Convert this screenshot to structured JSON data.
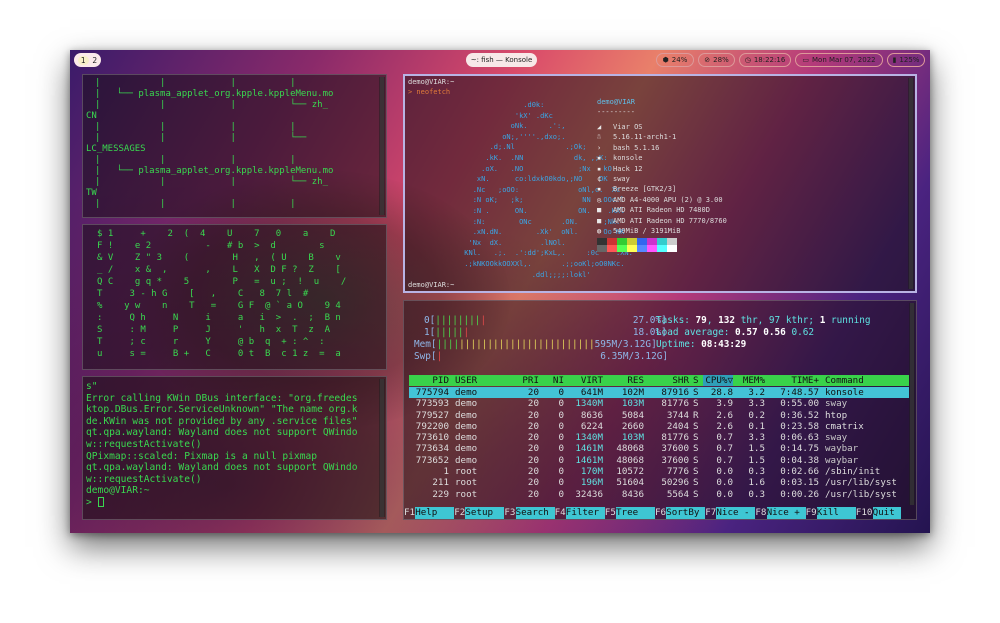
{
  "topbar": {
    "workspaces": [
      "1",
      "2"
    ],
    "window_title": "~: fish — Konsole",
    "gpu": "24%",
    "cpu": "28%",
    "clock": "18:22:16",
    "date": "Mon Mar 07, 2022",
    "battery": "125%"
  },
  "pane_tree": {
    "lines": [
      "|           |            |          |",
      "|   └── plasma_applet_org.kpple.kppleMenu.mo",
      "|           |            |          └── zh_",
      "CN",
      "|           |            |          |",
      "|           |            |          └──",
      "LC_MESSAGES",
      "|           |            |          |",
      "|   └── plasma_applet_org.kpple.kppleMenu.mo",
      "|           |            |          └── zh_",
      "TW",
      "|           |            |          |"
    ]
  },
  "pane_matrix": {
    "lines": [
      "$ 1     +    2  (  4    U    7   0    a    D",
      "F !    e 2          -   # b  >  d        s",
      "& V    Z \" 3    (        H   ,  ( U    B    v",
      "_ /    x &  ,       ,    L   X  D F ?  Z    [",
      "Q C    g q *    5        P   =  u ;  !  u    /",
      "T     3 - h G    [   ,    C   8  7 l  #",
      "%    y w    n    T   =    G F  @ ` a O    9 4",
      ":     Q h     N     i     a   i  >  .  ;  B n",
      "S     : M     P     J     '   h  x  T  z  A",
      "T     ; c     r     Y     @ b  q  + : ^  :",
      "u     s =     B +   C     0 t  B  c 1 z  =  a"
    ]
  },
  "pane_log": {
    "lines": [
      "s\"",
      "Error calling KWin DBus interface: \"org.freedes",
      "ktop.DBus.Error.ServiceUnknown\" \"The name org.k",
      "de.KWin was not provided by any .service files\"",
      "qt.qpa.wayland: Wayland does not support QWindo",
      "w::requestActivate()",
      "QPixmap::scaled: Pixmap is a null pixmap",
      "qt.qpa.wayland: Wayland does not support QWindo",
      "w::requestActivate()",
      "demo@VIAR:~",
      "> "
    ]
  },
  "neofetch": {
    "prompt": "demo@VIAR:~",
    "command": "> neofetch",
    "ascii": [
      "                    .d0k:",
      "                  'kX' .dKc",
      "                 oNk.     .':,",
      "               oN;,''''.,dxo;.",
      "            .d;.Nl            .;Ok;",
      "           .kK.  .NN            dk, ,;K:",
      "          .oX.   .NO             ;Nx   kO.",
      "         xN.      co:ldxkO0kdo,;NO    OK",
      "        .Nc   ;oOO:              oNl,c.  Xc",
      "        :N oK;   ;k;              NN  .OOc:l",
      "        :N .      ON.            ON.    .KXl",
      "        :N:        ONc       .ON.      ;Nk.",
      "        .xN.dN.        .Xk'  oNl.      Oo'NK",
      "       'Nx  dX.         .lNOl.         kN. ,Nk",
      "      KNl.   .;.  .':dd';KxL,.     :0c    .XN.",
      "      .;kNKOOkkOOXXl,.       .;;ooKl;oO0NKc.",
      "                      .ddl;;;;:lokl'"
    ],
    "user": "demo@VIAR",
    "separator": "---------",
    "info": [
      {
        "icon": "arch-icon",
        "glyph": "◢",
        "value": "Viar OS"
      },
      {
        "icon": "tux-icon",
        "glyph": "☃",
        "value": "5.16.11-arch1-1"
      },
      {
        "icon": "shell-icon",
        "glyph": "›",
        "value": "bash 5.1.16"
      },
      {
        "icon": "terminal-icon",
        "glyph": "▪",
        "value": "konsole"
      },
      {
        "icon": "font-icon",
        "glyph": "▪",
        "value": "Hack 12"
      },
      {
        "icon": "wm-icon",
        "glyph": "¢",
        "value": "sway"
      },
      {
        "icon": "theme-icon",
        "glyph": "▪",
        "value": "Breeze [GTK2/3]"
      },
      {
        "icon": "cpu-icon",
        "glyph": "◎",
        "value": "AMD A4-4000 APU (2) @ 3.00"
      },
      {
        "icon": "gpu-icon",
        "glyph": "■",
        "value": "AMD ATI Radeon HD 7480D"
      },
      {
        "icon": "gpu-icon",
        "glyph": "■",
        "value": "AMD ATI Radeon HD 7770/8760"
      },
      {
        "icon": "memory-icon",
        "glyph": "◍",
        "value": "549MiB / 3191MiB"
      }
    ],
    "palette_top": [
      "#333333",
      "#cc3333",
      "#33cc33",
      "#cccc33",
      "#3366ee",
      "#cc33cc",
      "#33cccc",
      "#cccccc"
    ],
    "palette_bottom": [
      "#666666",
      "#ff5555",
      "#55ff55",
      "#ffff55",
      "#5588ff",
      "#ff55ff",
      "#55ffff",
      "#ffffff"
    ],
    "prompt_end": "demo@VIAR:~"
  },
  "htop": {
    "cpu0_label": "0[",
    "cpu0_pct": "27.0%]",
    "cpu1_label": "1[",
    "cpu1_pct": "18.0%]",
    "mem_label": "Mem[",
    "mem_val": "595M/3.12G]",
    "swp_label": "Swp[",
    "swp_val": "6.35M/3.12G]",
    "tasks": "Tasks: 79, 132 thr, 97 kthr; 1 running",
    "tasks_n1": "79",
    "tasks_n2": "132",
    "tasks_n3": "1",
    "load": "Load average: 0.57 0.56 0.62",
    "uptime_label": "Uptime: ",
    "uptime": "08:43:29",
    "headers": [
      "PID",
      "USER",
      "PRI",
      "NI",
      "VIRT",
      "RES",
      "SHR",
      "S",
      "CPU%▽",
      "MEM%",
      "TIME+",
      "Command"
    ],
    "rows": [
      [
        "775794",
        "demo",
        "20",
        "0",
        "641M",
        "102M",
        "87916",
        "S",
        "28.8",
        "3.2",
        "7:48.57",
        "konsole"
      ],
      [
        "773593",
        "demo",
        "20",
        "0",
        "1340M",
        "103M",
        "81776",
        "S",
        "3.9",
        "3.3",
        "0:55.00",
        "sway"
      ],
      [
        "779527",
        "demo",
        "20",
        "0",
        "8636",
        "5084",
        "3744",
        "R",
        "2.6",
        "0.2",
        "0:36.52",
        "htop"
      ],
      [
        "792200",
        "demo",
        "20",
        "0",
        "6224",
        "2660",
        "2404",
        "S",
        "2.6",
        "0.1",
        "0:23.58",
        "cmatrix"
      ],
      [
        "773610",
        "demo",
        "20",
        "0",
        "1340M",
        "103M",
        "81776",
        "S",
        "0.7",
        "3.3",
        "0:06.63",
        "sway"
      ],
      [
        "773634",
        "demo",
        "20",
        "0",
        "1461M",
        "48068",
        "37600",
        "S",
        "0.7",
        "1.5",
        "0:14.75",
        "waybar"
      ],
      [
        "773652",
        "demo",
        "20",
        "0",
        "1461M",
        "48068",
        "37600",
        "S",
        "0.7",
        "1.5",
        "0:04.38",
        "waybar"
      ],
      [
        "1",
        "root",
        "20",
        "0",
        "170M",
        "10572",
        "7776",
        "S",
        "0.0",
        "0.3",
        "0:02.66",
        "/sbin/init"
      ],
      [
        "211",
        "root",
        "20",
        "0",
        "196M",
        "51604",
        "50296",
        "S",
        "0.0",
        "1.6",
        "0:03.15",
        "/usr/lib/syst"
      ],
      [
        "229",
        "root",
        "20",
        "0",
        "32436",
        "8436",
        "5564",
        "S",
        "0.0",
        "0.3",
        "0:00.26",
        "/usr/lib/syst"
      ]
    ],
    "fkeys": [
      {
        "key": "F1",
        "label": "Help  "
      },
      {
        "key": "F2",
        "label": "Setup "
      },
      {
        "key": "F3",
        "label": "Search"
      },
      {
        "key": "F4",
        "label": "Filter"
      },
      {
        "key": "F5",
        "label": "Tree  "
      },
      {
        "key": "F6",
        "label": "SortBy"
      },
      {
        "key": "F7",
        "label": "Nice -"
      },
      {
        "key": "F8",
        "label": "Nice +"
      },
      {
        "key": "F9",
        "label": "Kill  "
      },
      {
        "key": "F10",
        "label": "Quit"
      }
    ]
  }
}
